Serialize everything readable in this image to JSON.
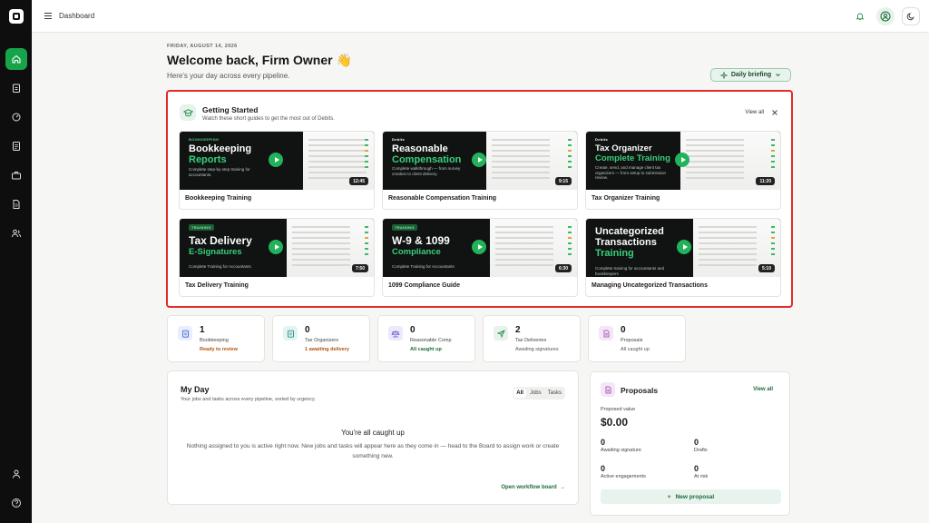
{
  "topbar": {
    "breadcrumb": "Dashboard"
  },
  "header": {
    "date": "FRIDAY, AUGUST 14, 2026",
    "welcome": "Welcome back, Firm Owner 👋",
    "subtitle": "Here's your day across every pipeline.",
    "briefing_label": "Daily briefing"
  },
  "getting_started": {
    "title": "Getting Started",
    "subtitle": "Watch these short guides to get the most out of Debits.",
    "view_all": "View all",
    "videos": [
      {
        "title": "Bookkeeping Training",
        "duration": "12:45",
        "tag": "BOOKKEEPING",
        "line1": "Bookkeeping",
        "line2": "Reports",
        "blurb": "Complete step-by-step training for accountants."
      },
      {
        "title": "Reasonable Compensation Training",
        "duration": "9:15",
        "tag": "Debits",
        "line1": "Reasonable",
        "line2": "Compensation",
        "blurb": "Complete walkthrough — from survey creation to client delivery."
      },
      {
        "title": "Tax Organizer Training",
        "duration": "11:20",
        "tag": "Debits",
        "line1": "Tax Organizer",
        "line2": "Complete Training",
        "blurb": "Create, send, and manage client tax organizers — from setup to submission review."
      },
      {
        "title": "Tax Delivery Training",
        "duration": "7:50",
        "tag": "TRAINING",
        "line1": "Tax Delivery",
        "line2": "E-Signatures",
        "blurb": "Complete Training for Accountants"
      },
      {
        "title": "1099 Compliance Guide",
        "duration": "6:30",
        "tag": "TRAINING",
        "line1": "W-9 & 1099",
        "line2": "Compliance",
        "blurb": "Complete Training for Accountants"
      },
      {
        "title": "Managing Uncategorized Transactions",
        "duration": "5:10",
        "tag": "",
        "line1": "Uncategorized",
        "line2": "Transactions",
        "line3": "Training",
        "blurb": "Complete training for accountants and bookkeepers"
      }
    ]
  },
  "stats": [
    {
      "count": "1",
      "label": "Bookkeeping",
      "status": "Ready to review",
      "status_color": "#b45309",
      "icon": "clipboard-icon",
      "icon_bg": "#e8eefb",
      "icon_color": "#3b5bd6"
    },
    {
      "count": "0",
      "label": "Tax Organizers",
      "status": "1 awaiting delivery",
      "status_color": "#b45309",
      "icon": "clipboard-icon",
      "icon_bg": "#e3f3f2",
      "icon_color": "#1f8f86"
    },
    {
      "count": "0",
      "label": "Reasonable Comp",
      "status": "All caught up",
      "status_color": "#1b6b3a",
      "icon": "scale-icon",
      "icon_bg": "#ece9fb",
      "icon_color": "#6a4fd6"
    },
    {
      "count": "2",
      "label": "Tax Deliveries",
      "status": "Awaiting signatures",
      "status_color": "#555555",
      "icon": "send-icon",
      "icon_bg": "#e6f2ea",
      "icon_color": "#1b8a48"
    },
    {
      "count": "0",
      "label": "Proposals",
      "status": "All caught up",
      "status_color": "#555555",
      "icon": "document-icon",
      "icon_bg": "#f3e7f6",
      "icon_color": "#9b3aae"
    }
  ],
  "myday": {
    "title": "My Day",
    "subtitle": "Your jobs and tasks across every pipeline, sorted by urgency.",
    "filters": [
      "All",
      "Jobs",
      "Tasks"
    ],
    "empty_title": "You're all caught up",
    "empty_text": "Nothing assigned to you is active right now. New jobs and tasks will appear here as they come in — head to the Board to assign work or create something new.",
    "workflow_link": "Open workflow board"
  },
  "proposals": {
    "title": "Proposals",
    "view_all": "View all",
    "value_label": "Proposed value",
    "value": "$0.00",
    "metrics": [
      {
        "n": "0",
        "l": "Awaiting signature"
      },
      {
        "n": "0",
        "l": "Drafts"
      },
      {
        "n": "0",
        "l": "Active engagements"
      },
      {
        "n": "0",
        "l": "At risk"
      }
    ],
    "new_label": "New proposal"
  },
  "colors": {
    "accent": "#16a34a",
    "highlight_border": "#e22a2a"
  }
}
